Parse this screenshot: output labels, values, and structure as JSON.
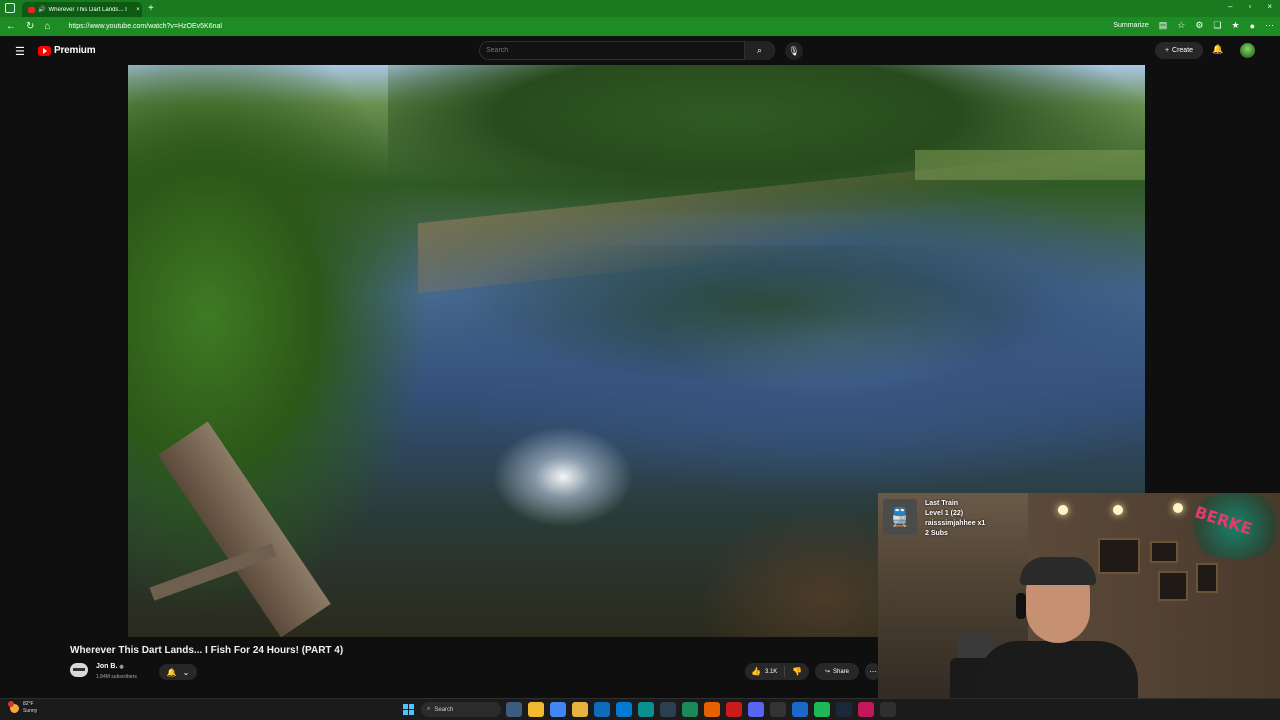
{
  "browser": {
    "tab_title": "Wherever This Dart Lands... I",
    "url": "https://www.youtube.com/watch?v=HzOEv5K6nal",
    "summarize_label": "Summarize",
    "new_tab": "+",
    "tab_close": "×",
    "window_controls": [
      "–",
      "▫",
      "×"
    ]
  },
  "youtube": {
    "logo_text": "Premium",
    "search_placeholder": "Search",
    "create_label": "Create"
  },
  "video": {
    "title": "Wherever This Dart Lands... I Fish For 24 Hours! (PART 4)",
    "channel_name": "Jon B.",
    "verified": "◉",
    "subscribers": "1.84M subscribers",
    "likes": "3.1K",
    "share_label": "Share"
  },
  "stream_overlay": {
    "alert_title": "Last Train",
    "alert_level": "Level 1  (22)",
    "alert_user": "raisssimjahhee x1",
    "alert_subs": "2 Subs",
    "logo_text": "BERKE"
  },
  "taskbar": {
    "temperature": "82°F",
    "weather_condition": "Sunny",
    "search_label": "Search",
    "apps": [
      {
        "name": "widgets",
        "color": "#3d5a80"
      },
      {
        "name": "file-explorer",
        "color": "#f2b830"
      },
      {
        "name": "chrome",
        "color": "#4285f4"
      },
      {
        "name": "folder",
        "color": "#e8b33d"
      },
      {
        "name": "store",
        "color": "#0f6cbd"
      },
      {
        "name": "mail",
        "color": "#0078d4"
      },
      {
        "name": "edge",
        "color": "#0c8f8f"
      },
      {
        "name": "app-dark",
        "color": "#2c3e50"
      },
      {
        "name": "app-green",
        "color": "#1a8a5a"
      },
      {
        "name": "firefox",
        "color": "#e66000"
      },
      {
        "name": "opera",
        "color": "#cc1b1b"
      },
      {
        "name": "discord",
        "color": "#5865f2"
      },
      {
        "name": "terminal",
        "color": "#333333"
      },
      {
        "name": "app-blue",
        "color": "#1b6ac9"
      },
      {
        "name": "spotify",
        "color": "#1db954"
      },
      {
        "name": "steam",
        "color": "#1b2838"
      },
      {
        "name": "app-pink",
        "color": "#c2185b"
      },
      {
        "name": "obs",
        "color": "#302e31"
      }
    ]
  }
}
